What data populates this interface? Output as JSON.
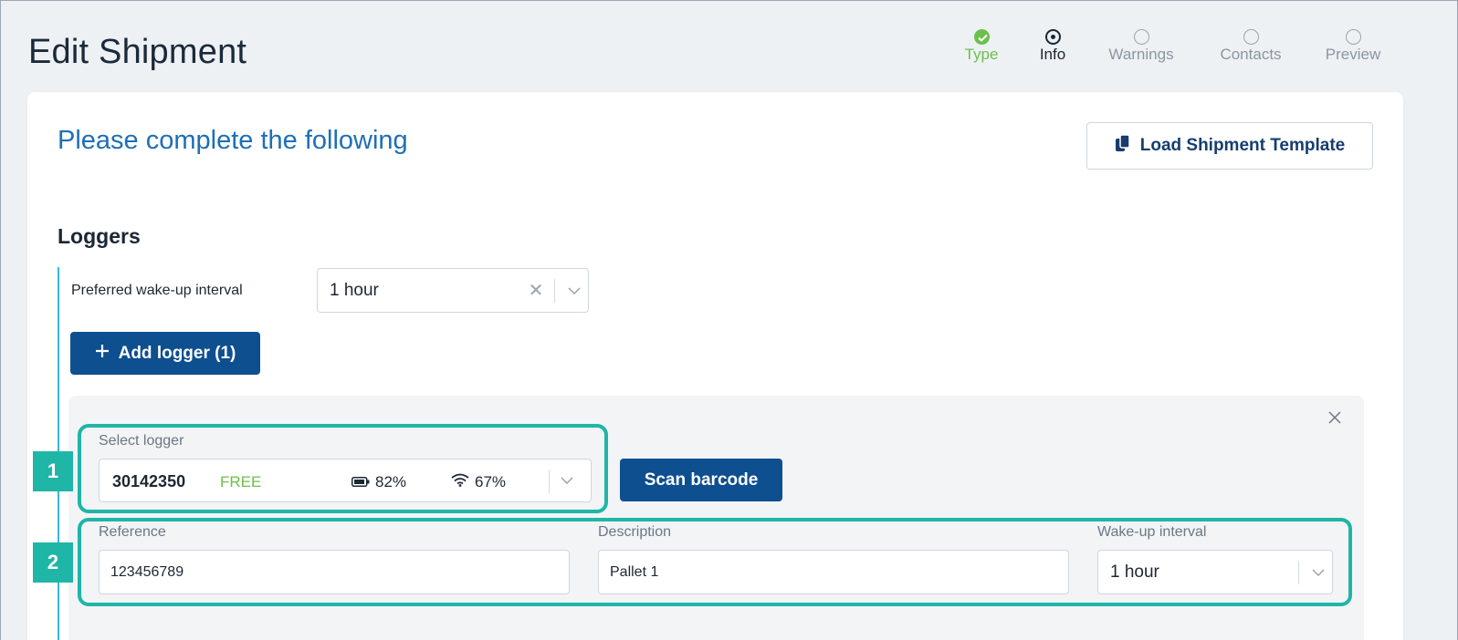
{
  "page": {
    "title": "Edit Shipment"
  },
  "stepper": [
    {
      "label": "Type",
      "state": "done"
    },
    {
      "label": "Info",
      "state": "current"
    },
    {
      "label": "Warnings",
      "state": "pending"
    },
    {
      "label": "Contacts",
      "state": "pending"
    },
    {
      "label": "Preview",
      "state": "pending"
    }
  ],
  "main": {
    "heading": "Please complete the following",
    "load_template_label": "Load Shipment Template",
    "loggers_title": "Loggers",
    "preferred_interval_label": "Preferred wake-up interval",
    "preferred_interval_value": "1 hour",
    "add_logger_label": "Add logger (1)"
  },
  "logger": {
    "select_label": "Select logger",
    "id": "30142350",
    "status": "FREE",
    "battery": "82%",
    "signal": "67%",
    "scan_label": "Scan barcode",
    "reference_label": "Reference",
    "reference_value": "123456789",
    "description_label": "Description",
    "description_value": "Pallet 1",
    "wakeup_label": "Wake-up interval",
    "wakeup_value": "1 hour"
  },
  "callouts": {
    "one": "1",
    "two": "2"
  },
  "colors": {
    "accent": "#0e4f8f",
    "heading_blue": "#1e6fb6",
    "success": "#6cc04a",
    "callout": "#1fb5a7",
    "section_line": "#39b7d6"
  },
  "icons": {
    "stepper_done": "check-circle-icon",
    "stepper_current": "radio-selected-icon",
    "stepper_pending": "radio-empty-icon",
    "template": "copy-document-icon",
    "add": "plus-icon",
    "clear": "close-icon",
    "dropdown": "chevron-down-icon",
    "battery": "battery-icon",
    "signal": "wifi-icon"
  }
}
